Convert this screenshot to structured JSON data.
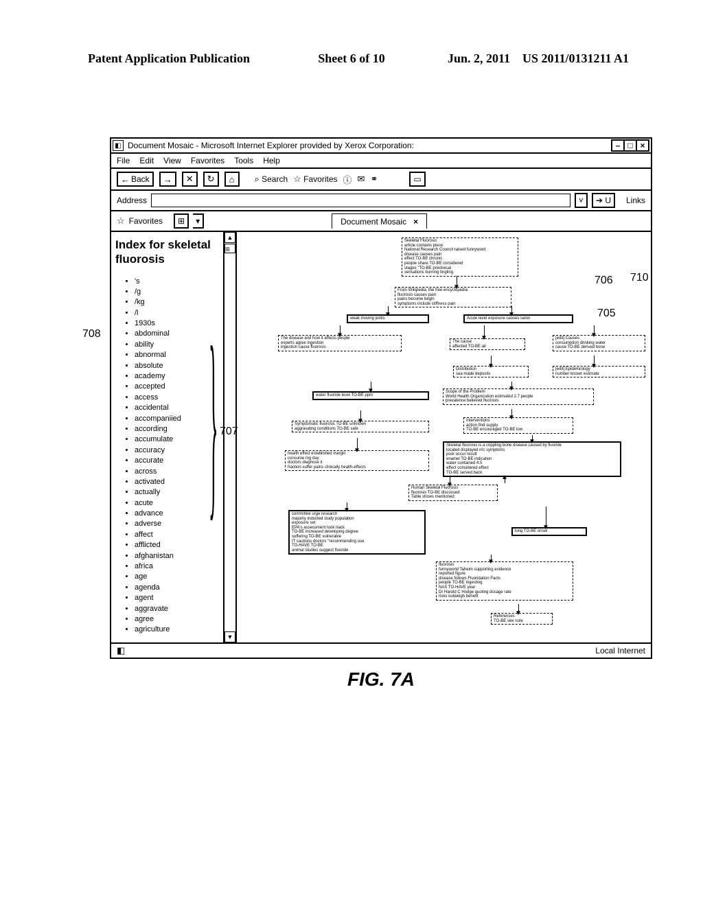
{
  "header": {
    "left": "Patent Application Publication",
    "sheet": "Sheet 6 of 10",
    "date": "Jun. 2, 2011",
    "pubno": "US 2011/0131211 A1"
  },
  "window": {
    "title": "Document Mosaic - Microsoft Internet Explorer provided by Xerox Corporation:",
    "minimize": "–",
    "maximize": "□",
    "close": "×"
  },
  "menu": {
    "items": [
      "File",
      "Edit",
      "View",
      "Favorites",
      "Tools",
      "Help"
    ]
  },
  "toolbar": {
    "back": "Back",
    "search": "Search",
    "favorites": "Favorites"
  },
  "addressbar": {
    "label": "Address",
    "go": "U",
    "links": "Links"
  },
  "favbar": {
    "favorites": "Favorites"
  },
  "tab": {
    "label": "Document Mosaic",
    "close": "×"
  },
  "sidebar": {
    "title": "Index for skeletal fluorosis",
    "items": [
      "'s",
      "/g",
      "/kg",
      "/l",
      "1930s",
      "abdominal",
      "ability",
      "abnormal",
      "absolute",
      "academy",
      "accepted",
      "access",
      "accidental",
      "accompaniied",
      "according",
      "accumulate",
      "accuracy",
      "accurate",
      "across",
      "activated",
      "actually",
      "acute",
      "advance",
      "adverse",
      "affect",
      "afflicted",
      "afghanistan",
      "africa",
      "age",
      "agenda",
      "agent",
      "aggravate",
      "agree",
      "agriculture"
    ]
  },
  "refs": {
    "r705": "705",
    "r706": "706",
    "r707": "707",
    "r708": "708",
    "r710": "710"
  },
  "mosaic": {
    "n1": [
      "Skeletal Fluorosis",
      "article contains piece",
      "National Research Council  raised funnyword",
      "disease causes pain",
      "effect TO-BE chronic",
      "people share TO-BE considered",
      "stages \"TO-BE preclinical",
      "sensations burning tingling"
    ],
    "n2": [
      "From Wikipedia, the free encyclopedia",
      "fluorosis causes pain",
      "pains become begin",
      "symptoms include stiffness pain"
    ],
    "n3_left": [
      "weak moving joints"
    ],
    "n3_right": [
      "Acute level exposure causes salon"
    ],
    "n4_left": [
      "The disease and how it affects people",
      "experts agree ingestion",
      "ingestion cause fluorosis"
    ],
    "n4_mid": [
      "The cause",
      "affected TO-BE air"
    ],
    "n4_right": [
      "[edit] Causes",
      "consumption drinking water",
      "cause TO-BE derived bone"
    ],
    "n5_left": [
      "Distribution",
      "sea made deposits"
    ],
    "n5_right": [
      "[edit] Epidemiology",
      "number known estimate"
    ],
    "n6_left": [
      "water fluoride level TO-BE ppm"
    ],
    "n6_right": [
      "Scope of the Problem",
      "World Health Organization estimated 2.7 people",
      "prevalence believed fluorosis"
    ],
    "n7_left": [
      "Symptomatic fluorosis TO-BE unknown",
      "aggravating conditions TO-BE safe"
    ],
    "n7_right": [
      "Interventions",
      "action find supply",
      "TO-BE encouraged TO-BE low"
    ],
    "n8_left": [
      "health effect established margin",
      "consume mg day",
      "doctors diagnose it",
      "fraction suffer pains clinically health-effects"
    ],
    "n8_right": [
      "Skeletal fluorosis is a crippling bone disease caused by fluoride",
      "located displayed nrc  symptoms",
      "poor occur result",
      "enamel TO-BE indication",
      "water contained 4.5",
      "effect considered effect",
      "TO-BE served back"
    ],
    "n9_mid": [
      "Human Skeletal Fluorosis",
      "fluorosis TO-BE discussed",
      "Table shows mentioned"
    ],
    "n10_left": [
      "committee urge research",
      "majority inducted study population",
      "exposure set",
      "EPA's assessment took track",
      "TO-BE increased developing degree",
      "suffering TO-BE vulnerable",
      "IT cautions doctors \"recommending use",
      "TO-HAVE TO-BE",
      "animal studies suggest fluoride"
    ],
    "n10_right": [
      "long TO-BE onset"
    ],
    "n11_mid": [
      "fluorosis",
      "funnyworld Taheim supporting evidence",
      "reported figure",
      "disease follows Fluoridation Facts",
      "people TO-BE ingesting",
      "NAS TO-HAVE year",
      "Dr Harold C Hodge quoting dosage rate",
      "risks outweigh benefit"
    ],
    "n12": [
      "References",
      "TO-BE see note"
    ]
  },
  "status": {
    "right": "Local Internet"
  },
  "figure_label": "FIG. 7A"
}
